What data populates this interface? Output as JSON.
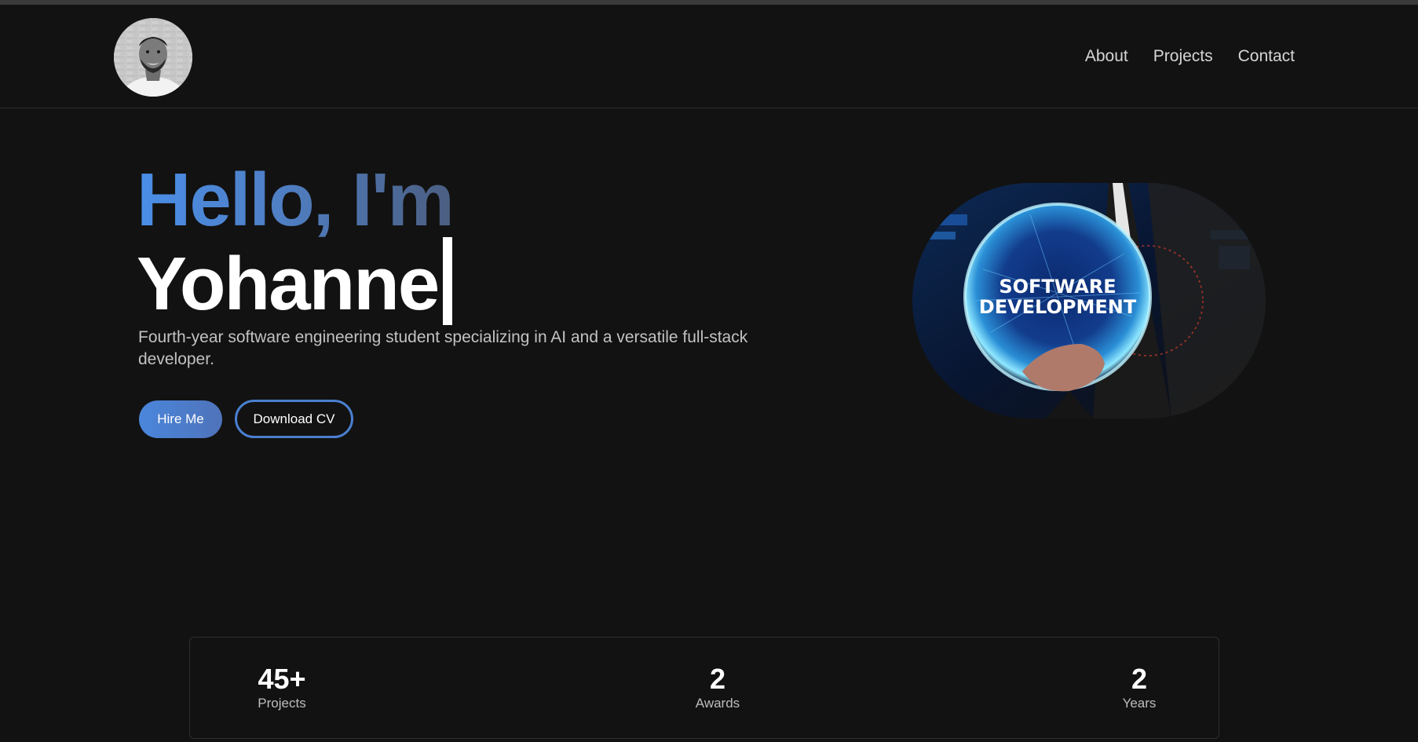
{
  "nav": {
    "items": [
      {
        "label": "About"
      },
      {
        "label": "Projects"
      },
      {
        "label": "Contact"
      }
    ]
  },
  "hero": {
    "greeting": "Hello, I'm",
    "name": "Yohanne",
    "subtitle": "Fourth-year software engineering student specializing in AI and a versatile full-stack developer.",
    "hire_label": "Hire Me",
    "cv_label": "Download CV",
    "image_text_1": "SOFTWARE",
    "image_text_2": "DEVELOPMENT"
  },
  "stats": [
    {
      "value": "45+",
      "label": "Projects"
    },
    {
      "value": "2",
      "label": "Awards"
    },
    {
      "value": "2",
      "label": "Years"
    }
  ],
  "colors": {
    "background": "#121212",
    "accent": "#4a86dc",
    "accent_dark": "#4b5e80"
  }
}
